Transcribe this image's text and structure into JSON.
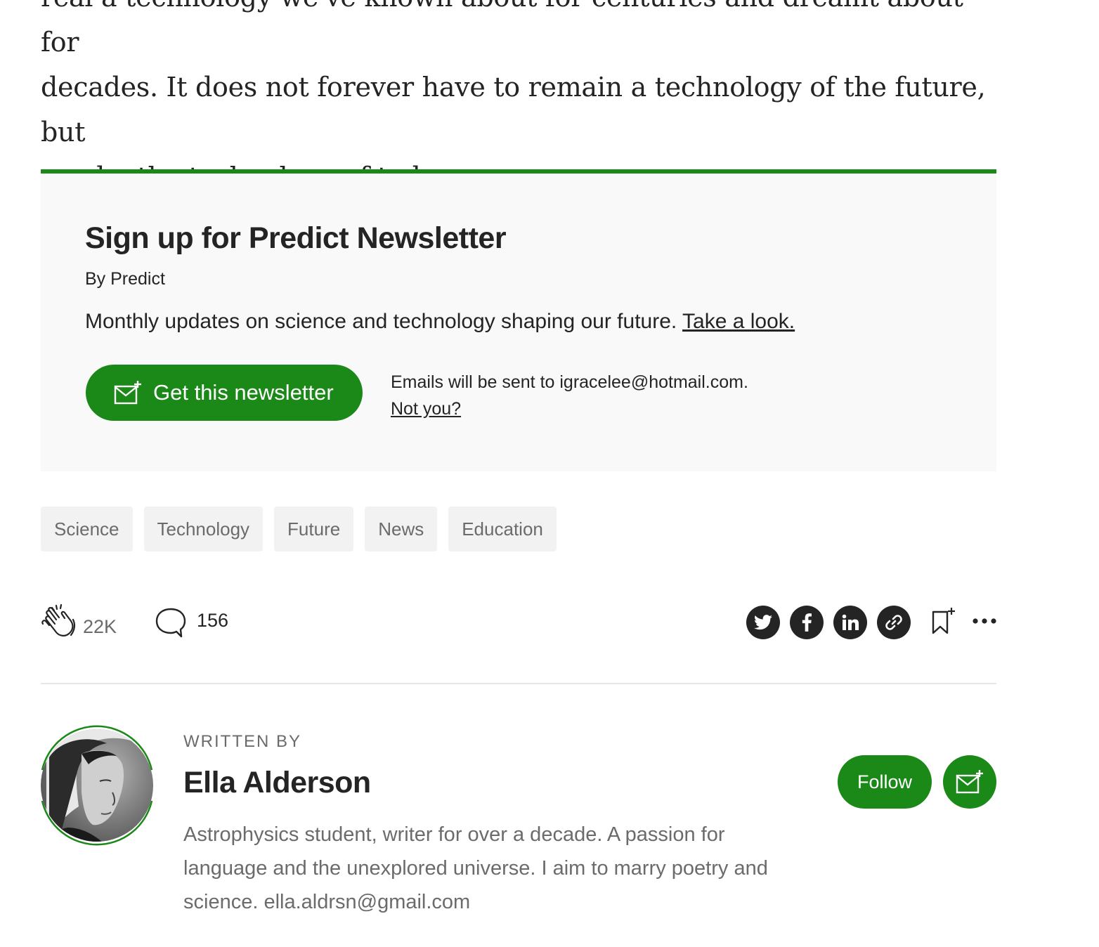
{
  "article": {
    "lines": [
      "real a technology we've known about for centuries and dreamt about for",
      "decades. It does not forever have to remain a technology of the future, but",
      "can be the technology of today."
    ]
  },
  "newsletter": {
    "title": "Sign up for Predict Newsletter",
    "by": "By Predict",
    "description": "Monthly updates on science and technology shaping our future.",
    "link_label": "Take a look.",
    "button_label": "Get this newsletter",
    "email_note": "Emails will be sent to igracelee@hotmail.com.",
    "not_you": "Not you?",
    "accent_color": "#1a8917"
  },
  "tags": [
    "Science",
    "Technology",
    "Future",
    "News",
    "Education"
  ],
  "actions": {
    "claps": "22K",
    "responses": "156",
    "share_icons": [
      "twitter-icon",
      "facebook-icon",
      "linkedin-icon",
      "link-icon"
    ]
  },
  "author": {
    "written_by": "WRITTEN BY",
    "name": "Ella Alderson",
    "bio": "Astrophysics student, writer for over a decade. A passion for language and the unexplored universe. I aim to marry poetry and science. ella.aldrsn@gmail.com",
    "follow_label": "Follow"
  }
}
